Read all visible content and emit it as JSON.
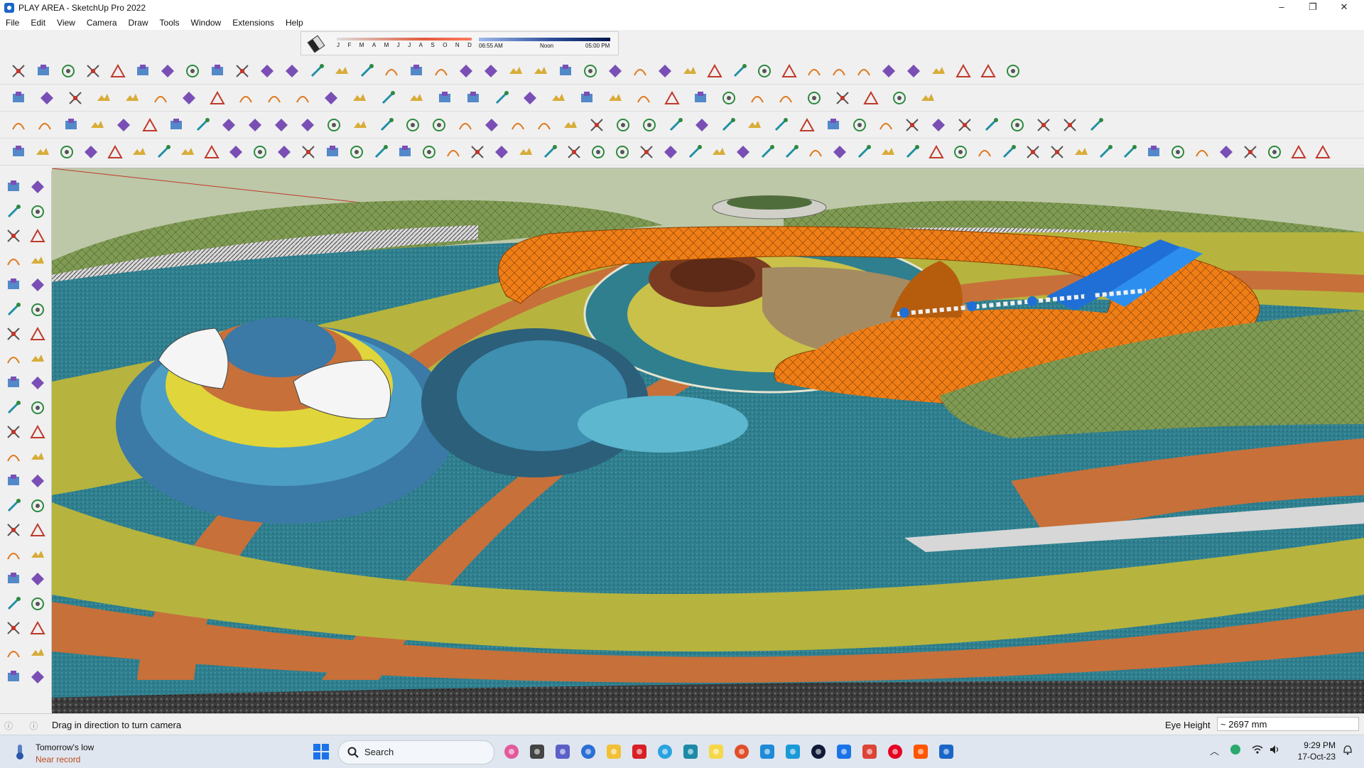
{
  "window": {
    "title": "PLAY AREA - SketchUp Pro 2022",
    "controls": [
      "–",
      "❐",
      "✕"
    ]
  },
  "menu": [
    "File",
    "Edit",
    "View",
    "Camera",
    "Draw",
    "Tools",
    "Window",
    "Extensions",
    "Help"
  ],
  "shadows": {
    "months": [
      "J",
      "F",
      "M",
      "A",
      "M",
      "J",
      "J",
      "A",
      "S",
      "O",
      "N",
      "D"
    ],
    "time_start": "06:55 AM",
    "time_mid": "Noon",
    "time_end": "05:00 PM"
  },
  "status": {
    "message": "Drag in direction to turn camera",
    "measure_label": "Eye Height",
    "measure_value": "~ 2697 mm"
  },
  "taskbar": {
    "weather_line1": "Tomorrow's low",
    "weather_line2": "Near record",
    "search_label": "Search",
    "time": "9:29 PM",
    "date": "17-Oct-23"
  },
  "colors": {
    "sky": "#bdc8a8",
    "ground_teal": "#2f7f8f",
    "terrain_orange": "#f07e16",
    "path_brown": "#c7703a",
    "lawn_olive": "#a9b33f",
    "accent_blue": "#1f6fd6"
  },
  "icons": {
    "toolbar1": [
      "freehand-icon",
      "arc-icon",
      "pie-icon",
      "two-point-arc-icon",
      "polygon-icon",
      "sandbox-icon",
      "follow-me-icon",
      "sphere-icon",
      "loft-icon",
      "extrude-icon",
      "curve-icon",
      "line-icon",
      "bezier-icon",
      "tube-icon",
      "cone-icon",
      "columns-icon",
      "grid-icon",
      "slice-icon",
      "loft2-icon",
      "join-icon",
      "split-icon",
      "weld-icon",
      "offset-icon",
      "bridge-icon",
      "flatten-icon",
      "shell-icon",
      "taper-icon",
      "stairs-icon",
      "pattern-icon",
      "hatch-icon",
      "lattice-icon",
      "fins-icon",
      "spiral-icon",
      "twist-icon",
      "wave-icon",
      "mesh-icon",
      "box-icon",
      "wall-icon",
      "house-icon",
      "roof-icon",
      "gable-icon"
    ],
    "toolbar2": [
      "zoom-icon",
      "select-icon",
      "eraser-icon",
      "pencil-icon",
      "shape-icon",
      "rectangle-icon",
      "push-pull-icon",
      "move-icon",
      "rotate-icon",
      "scale-icon",
      "tape-icon",
      "text-icon",
      "paint-icon",
      "orbit-icon",
      "pan-icon",
      "zoom2-icon",
      "zoom-extents-icon",
      "warehouse-icon",
      "ext-warehouse-icon",
      "layers-icon",
      "sections-icon",
      "user-icon",
      "sandbox2-icon",
      "add-location-icon",
      "send-icon",
      "mark-icon",
      "orange-arrow-icon",
      "green-arrow-icon",
      "move-axis-icon",
      "rotate-axis-icon",
      "red-x-icon",
      "purple-icon",
      "curvature-icon"
    ],
    "toolbar3": [
      "camera-icon",
      "box3d-icon",
      "components-icon",
      "styles-icon",
      "fog-icon",
      "shadow-icon",
      "scenes-icon",
      "match-photo-icon",
      "outline-icon",
      "soften-icon",
      "ruler-icon",
      "cube-icon",
      "line-edit-icon",
      "loop-icon",
      "ring-icon",
      "bubble-icon",
      "lasso-icon",
      "knife-icon",
      "brush-icon",
      "cut-icon",
      "move-gizmo-icon",
      "select-gizmo-icon",
      "box-select-icon",
      "mirror-icon",
      "align-icon",
      "component-icon",
      "plane-icon",
      "sphere2-icon",
      "round-icon",
      "donut-icon",
      "cone2-icon",
      "torus-icon",
      "chain-icon",
      "frame-icon",
      "window-icon",
      "door-icon",
      "tile-icon",
      "brick-icon",
      "red-box-icon",
      "green-box-icon",
      "grey-box-icon",
      "brown-box-icon"
    ],
    "toolbar4": [
      "gear-icon",
      "umbrella-icon",
      "orb-icon",
      "sail-icon",
      "pergola-icon",
      "star-icon",
      "dome-icon",
      "hemisphere-icon",
      "solid-union-icon",
      "solid-subtract-icon",
      "iso-icon",
      "iso2-icon",
      "iso3-icon",
      "sphere3-icon",
      "sphere4-icon",
      "hand-select-icon",
      "diamond-blue-icon",
      "diamond-cyan-icon",
      "diamond-gold-icon",
      "diamond-green-icon",
      "diamond-red-icon",
      "diamond-grey-icon",
      "curl-icon",
      "red-block-icon",
      "stack-icon",
      "flag-icon",
      "bundle-icon",
      "link-icon",
      "curve2-icon",
      "path-icon",
      "cross-red-icon",
      "cross-green-icon",
      "cross-blue-icon",
      "cone3-icon",
      "cone4-icon",
      "caution-icon",
      "curl2-icon",
      "curl3-icon",
      "swirl-icon",
      "anchor-icon",
      "bucket-icon",
      "horseshoe-icon",
      "figure-icon",
      "chair-icon",
      "table-icon",
      "bench-icon",
      "gift-icon",
      "mesh2-icon",
      "plate-icon",
      "crate-icon",
      "grid2-icon",
      "grid3-icon",
      "arrow-out-icon",
      "curve3-icon",
      "grid4-icon"
    ],
    "left": [
      "select-icon",
      "orbit-icon",
      "paint-bucket-icon",
      "eraser-icon",
      "components-icon",
      "pencil-icon",
      "line-icon",
      "freehand-icon",
      "rectangle-icon",
      "rotated-rect-icon",
      "circle-icon",
      "polygon-icon",
      "arc-icon",
      "two-point-arc-icon",
      "three-point-arc-icon",
      "pie-icon",
      "move-icon",
      "push-pull-icon",
      "rotate-icon",
      "follow-me-icon",
      "scale-icon",
      "offset-icon",
      "tape-measure-icon",
      "dimension-icon",
      "protractor-icon",
      "text-icon",
      "axes-icon",
      "3d-text-icon",
      "orbit2-icon",
      "pan-icon",
      "zoom-icon",
      "zoom-window-icon",
      "zoom-extents-icon",
      "previous-view-icon",
      "position-camera-icon",
      "look-around-icon",
      "walk-icon",
      "section-plane-icon",
      "warehouse-icon",
      "ext-warehouse-icon",
      "layer-icon",
      "sandbox-icon"
    ]
  }
}
